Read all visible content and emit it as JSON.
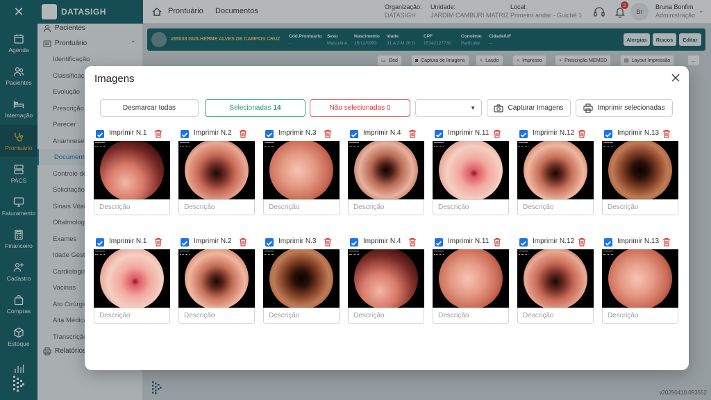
{
  "app": {
    "brand": "DATASIGH",
    "version": "v20250410.093552"
  },
  "rail": [
    {
      "label": "Agenda",
      "icon": "calendar-icon"
    },
    {
      "label": "Pacientes",
      "icon": "users-icon"
    },
    {
      "label": "Internação",
      "icon": "bed-icon"
    },
    {
      "label": "Prontuário",
      "icon": "stethoscope-icon",
      "active": true
    },
    {
      "label": "PACS",
      "icon": "server-icon"
    },
    {
      "label": "Faturamento",
      "icon": "monitor-icon"
    },
    {
      "label": "Financeiro",
      "icon": "calculator-icon"
    },
    {
      "label": "Cadastro",
      "icon": "user-plus-icon"
    },
    {
      "label": "Compras",
      "icon": "bag-icon"
    },
    {
      "label": "Estoque",
      "icon": "box-icon"
    },
    {
      "label": "",
      "icon": "bar-chart-icon"
    }
  ],
  "sidebar": {
    "pacientes": "Pacientes",
    "prontuario": "Prontuário",
    "items": [
      "Identificação",
      "Classificação",
      "Evolução",
      "Prescrição",
      "Parecer",
      "Anamnese",
      "Documentos",
      "Controle de",
      "Solicitação",
      "Sinais Vitais",
      "Oftalmologia",
      "Exames",
      "Idade Gesta",
      "Cardiologia",
      "Vacinas",
      "Ato Cirúrgico",
      "Alta Médica",
      "Transcrição"
    ],
    "relatorios": "Relatórios"
  },
  "header": {
    "crumb1": "Prontuário",
    "crumb2": "Documentos",
    "org_label": "Organização:",
    "org_value": "DATASIGH",
    "unit_label": "Unidade:",
    "unit_value": "JARDIM CAMBURI MATRIZ",
    "local_label": "Local:",
    "local_value": "Primeiro andar - Guichê 1",
    "notifications": "2",
    "avatar": "Br",
    "user_name": "Bruna Bonfim",
    "user_role": "Administração"
  },
  "patient": {
    "name": "#55038 GUILHERME ALVES DE CAMPOS CRUZ",
    "fields": [
      {
        "label": "Cód.Prontuário",
        "value": "-"
      },
      {
        "label": "Sexo",
        "value": "Masculino"
      },
      {
        "label": "Nascimento",
        "value": "15/12/1993"
      },
      {
        "label": "Idade",
        "value": "31 A 3 M 26 D"
      },
      {
        "label": "CPF",
        "value": "15142127730"
      },
      {
        "label": "Convênio",
        "value": "Particular"
      },
      {
        "label": "Cidade/UF",
        "value": "--"
      }
    ],
    "buttons": [
      "Alergias",
      "Riscos",
      "Editar"
    ]
  },
  "toolbar": [
    "Ged",
    "Captura de Imagens",
    "Laudo",
    "Impresso",
    "Prescrição MEMED",
    "Layout Impressão",
    "..."
  ],
  "modal": {
    "title": "Imagens",
    "deselect_all": "Desmarcar todas",
    "selected_label": "Selecionadas",
    "selected_count": "14",
    "unselected_label": "Não selecionadas 0",
    "dropdown_value": "",
    "capture": "Capturar Imagens",
    "print_selected": "Imprimir selecionadas",
    "description_placeholder": "Descrição",
    "row1": [
      {
        "label": "Imprimir N.1",
        "tone": "a"
      },
      {
        "label": "Imprimir N.2",
        "tone": "b"
      },
      {
        "label": "Imprimir N.3",
        "tone": "c"
      },
      {
        "label": "Imprimir N.4",
        "tone": "d"
      },
      {
        "label": "Imprimir N.11",
        "tone": "e"
      },
      {
        "label": "Imprimir N.12",
        "tone": "f"
      },
      {
        "label": "Imprimir N.13",
        "tone": "g"
      }
    ],
    "row2": [
      {
        "label": "Imprimir N.1",
        "tone": "e"
      },
      {
        "label": "Imprimir N.2",
        "tone": "f"
      },
      {
        "label": "Imprimir N.3",
        "tone": "g"
      },
      {
        "label": "Imprimir N.4",
        "tone": "a"
      },
      {
        "label": "Imprimir N.11",
        "tone": "c"
      },
      {
        "label": "Imprimir N.12",
        "tone": "b"
      },
      {
        "label": "Imprimir N.13",
        "tone": "c"
      }
    ]
  },
  "colors": {
    "primary": "#0d5c63",
    "accent": "#f2b233",
    "selected_green": "#2fae74",
    "unselected_red": "#e05555",
    "checkbox_blue": "#1a73e8"
  }
}
